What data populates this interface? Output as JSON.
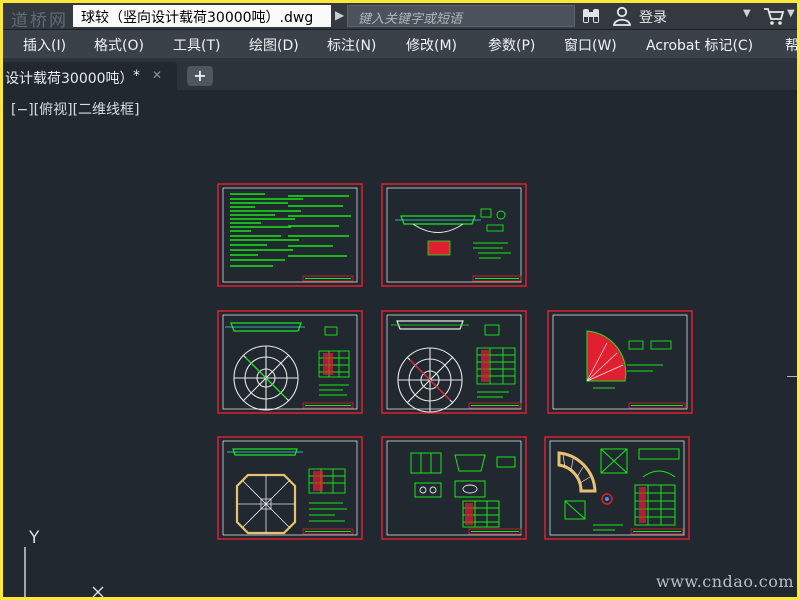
{
  "window": {
    "logo": "道桥网",
    "title": "球较（竖向设计载荷30000吨）.dwg",
    "search_placeholder": "键入关键字或短语",
    "login_label": "登录",
    "icons": [
      "binoculars-icon",
      "user-icon",
      "chevron-down-icon",
      "cart-icon"
    ]
  },
  "menu": {
    "items": [
      "插入(I)",
      "格式(O)",
      "工具(T)",
      "绘图(D)",
      "标注(N)",
      "修改(M)",
      "参数(P)",
      "窗口(W)",
      "Acrobat 标记(C)",
      "帮"
    ]
  },
  "tabs": {
    "active_label": "设计载荷30000吨）",
    "modified_marker": "*",
    "close_glyph": "✕",
    "new_tab_glyph": "+"
  },
  "viewport": {
    "label": "[−][俯视][二维线框]",
    "ucs_y_label": "Y",
    "watermark": "www.cndao.com",
    "sheet_count": 8
  },
  "colors": {
    "background": "#212830",
    "sheet_border": "#e02030",
    "linework": "#19e619",
    "highlight": "#e03030",
    "frame": "#fce83a"
  }
}
